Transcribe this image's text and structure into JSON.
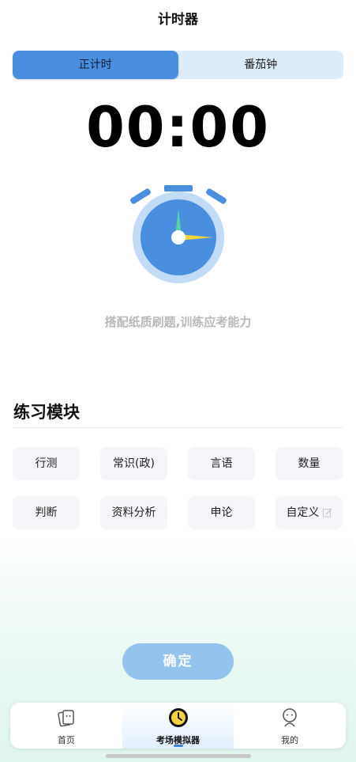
{
  "page": {
    "title": "计时器"
  },
  "mode_tabs": [
    {
      "label": "正计时",
      "active": true
    },
    {
      "label": "番茄钟",
      "active": false
    }
  ],
  "timer": {
    "display": "00:00"
  },
  "illustration": {
    "icon": "stopwatch-icon"
  },
  "hint": "搭配纸质刷题,训练应考能力",
  "practice": {
    "section_title": "练习模块",
    "modules": [
      "行测",
      "常识(政)",
      "言语",
      "数量",
      "判断",
      "资料分析",
      "申论",
      "自定义"
    ]
  },
  "confirm_label": "确定",
  "tabbar": {
    "items": [
      {
        "label": "首页",
        "icon": "home-cards-icon",
        "active": false
      },
      {
        "label": "考场模拟器",
        "icon": "clock-icon",
        "active": true
      },
      {
        "label": "我的",
        "icon": "profile-icon",
        "active": false
      }
    ]
  },
  "colors": {
    "accent": "#4a8ee0",
    "segment_bg": "#dcecfb",
    "confirm_bg": "#94c3ee",
    "clock_yellow": "#f3d33a",
    "hint_text": "#b8b8b8"
  }
}
